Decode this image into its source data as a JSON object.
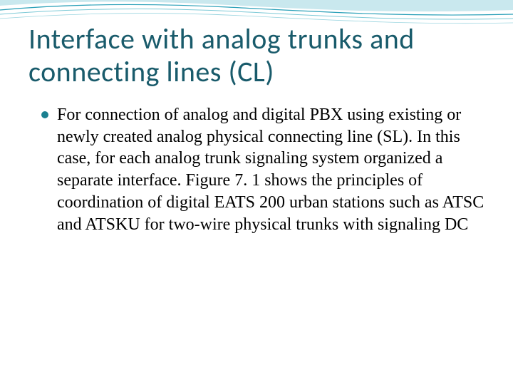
{
  "slide": {
    "title": "Interface with analog trunks and connecting lines (CL)",
    "bullets": [
      {
        "text": "For connection of analog and digital PBX using existing or newly created analog physical connecting line (SL). In this case, for each analog trunk signaling system organized a separate interface. Figure 7. 1 shows the principles of coordination of digital EATS 200 urban stations such as ATSC and ATSKU for two-wire physical trunks with signaling DC"
      }
    ]
  },
  "theme": {
    "title_color": "#195b6b",
    "bullet_color": "#1a8090",
    "wave_color_1": "#2aa0b8",
    "wave_color_2": "#7cc9d6"
  }
}
